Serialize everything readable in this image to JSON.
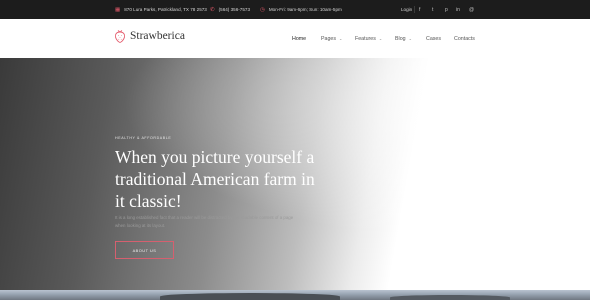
{
  "topbar": {
    "address": "870 Lura Parks, Patrickland, TX 78 2573",
    "phone": "(564) 356-7573",
    "hours": "Mon-Fri: 9am-6pm; Sun: 10am-5pm",
    "login": "Login",
    "social": [
      "f",
      "t",
      "p",
      "in",
      "@"
    ]
  },
  "header": {
    "brand": "Strawberica",
    "nav": [
      {
        "label": "Home",
        "active": true
      },
      {
        "label": "Pages",
        "dropdown": true
      },
      {
        "label": "Features",
        "dropdown": true
      },
      {
        "label": "Blog",
        "dropdown": true
      },
      {
        "label": "Cases"
      },
      {
        "label": "Contacts"
      }
    ]
  },
  "hero": {
    "kicker": "HEALTHY & AFFORDABLE",
    "headline": "When you picture yourself a traditional American farm in it classic!",
    "description": "It is a long established fact that a reader will be distracted by the readable content of a page when looking at its layout.",
    "button": "ABOUT US"
  },
  "colors": {
    "accent": "#e45a6b",
    "topbar_bg": "#1c1c1c"
  }
}
